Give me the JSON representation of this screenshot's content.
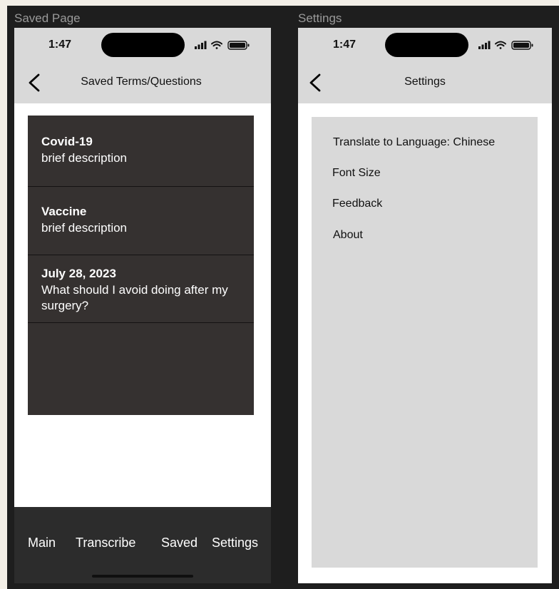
{
  "frames": {
    "saved_label": "Saved Page",
    "settings_label": "Settings"
  },
  "status_bar": {
    "time": "1:47",
    "icons": [
      "cellular-signal-icon",
      "wifi-icon",
      "battery-icon"
    ]
  },
  "saved_page": {
    "nav_title": "Saved Terms/Questions",
    "back_icon": "chevron-left-icon",
    "items": [
      {
        "title": "Covid-19",
        "description": "brief description"
      },
      {
        "title": "Vaccine",
        "description": "brief description"
      },
      {
        "title": "July 28, 2023",
        "description": "What should I avoid doing after my surgery?"
      }
    ],
    "tabs": [
      {
        "label": "Main"
      },
      {
        "label": "Transcribe"
      },
      {
        "label": "Saved"
      },
      {
        "label": "Settings"
      }
    ]
  },
  "settings_page": {
    "nav_title": "Settings",
    "back_icon": "chevron-left-icon",
    "options": [
      {
        "label": "Translate to Language: Chinese"
      },
      {
        "label": "Font Size"
      },
      {
        "label": "Feedback"
      },
      {
        "label": "About"
      }
    ]
  },
  "colors": {
    "header_gray": "#d9d9d9",
    "list_dark": "#353130",
    "tab_bar": "#2c2c2c",
    "canvas": "#1e1e1e"
  }
}
